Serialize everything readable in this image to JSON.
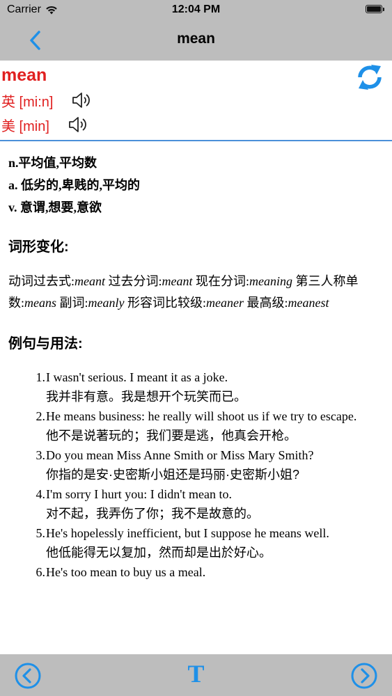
{
  "status": {
    "carrier": "Carrier",
    "time": "12:04 PM"
  },
  "nav": {
    "title": "mean"
  },
  "word": {
    "headword": "mean",
    "pron_uk": "英 [mi:n]",
    "pron_us": "美 [min]"
  },
  "definitions": [
    "n.平均值,平均数",
    "a. 低劣的,卑贱的,平均的",
    "v. 意谓,想要,意欲"
  ],
  "forms_section": {
    "title": "词形变化:",
    "items": [
      {
        "label": "动词过去式:",
        "value": "meant"
      },
      {
        "label": "过去分词:",
        "value": "meant"
      },
      {
        "label": "现在分词:",
        "value": "meaning"
      },
      {
        "label": "第三人称单数:",
        "value": "means"
      },
      {
        "label": "副词:",
        "value": "meanly"
      },
      {
        "label": "形容词比较级:",
        "value": "meaner"
      },
      {
        "label": "最高级:",
        "value": "meanest"
      }
    ]
  },
  "examples_section": {
    "title": "例句与用法:",
    "items": [
      {
        "num": "1.",
        "en": "I wasn't serious. I meant it as a joke.",
        "zh": "我并非有意。我是想开个玩笑而已。"
      },
      {
        "num": "2.",
        "en": "He means business: he really will shoot us if we try to escape.",
        "zh": "他不是说著玩的；我们要是逃，他真会开枪。"
      },
      {
        "num": "3.",
        "en": "Do you mean Miss Anne Smith or Miss Mary Smith?",
        "zh": "你指的是安·史密斯小姐还是玛丽·史密斯小姐?"
      },
      {
        "num": "4.",
        "en": "I'm sorry I hurt you: I didn't mean to.",
        "zh": "对不起，我弄伤了你；我不是故意的。"
      },
      {
        "num": "5.",
        "en": "He's hopelessly inefficient, but I suppose he means well.",
        "zh": "他低能得无以复加，然而却是出於好心。"
      },
      {
        "num": "6.",
        "en": "He's too mean to buy us a meal.",
        "zh": ""
      }
    ]
  },
  "toolbar": {
    "text_label": "T"
  },
  "colors": {
    "accent": "#1e90e8",
    "headword": "#e02020",
    "bar": "#bdbdbd"
  }
}
